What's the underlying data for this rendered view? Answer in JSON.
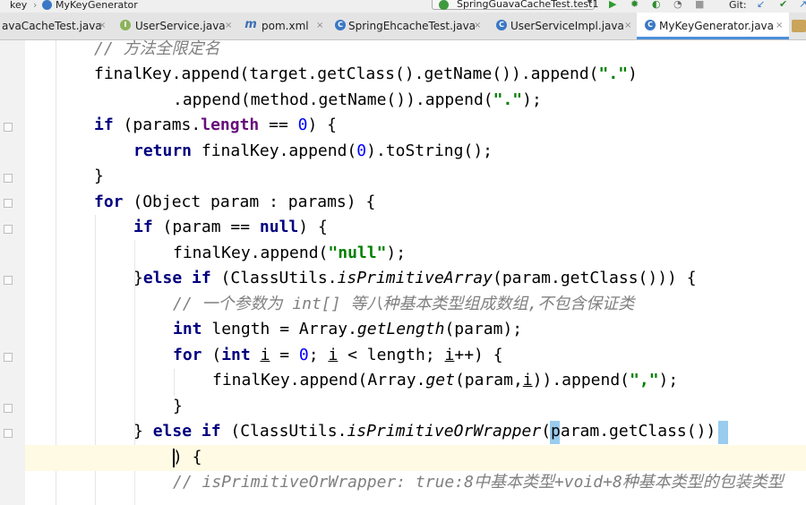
{
  "navbar": {
    "crumb_project": "key",
    "crumb_class": "MyKeyGenerator",
    "run_config": "SpringGuavaCacheTest.test1",
    "vcs_label": "Git:"
  },
  "tabs": [
    {
      "label": "avaCacheTest.java",
      "icon": "class-icon",
      "active": false
    },
    {
      "label": "UserService.java",
      "icon": "interface-icon",
      "active": false
    },
    {
      "label": "pom.xml",
      "icon": "maven-icon",
      "active": false
    },
    {
      "label": "SpringEhcacheTest.java",
      "icon": "test-class-icon",
      "active": false
    },
    {
      "label": "UserServiceImpl.java",
      "icon": "class-icon",
      "active": false
    },
    {
      "label": "MyKeyGenerator.java",
      "icon": "class-icon",
      "active": true
    }
  ],
  "tab_close_glyph": "×",
  "code": {
    "l1": {
      "cmt": "// 方法全限定名"
    },
    "l2": {
      "a": "finalKey.append(target.getClass().getName()).append(",
      "s": "\".\"",
      "b": ")"
    },
    "l3": {
      "a": ".append(method.getName()).append(",
      "s": "\".\"",
      "b": ");"
    },
    "l4": {
      "kw": "if",
      "a": " (params.",
      "f": "length",
      "b": " == ",
      "n": "0",
      "c": ") {"
    },
    "l5": {
      "kw": "return",
      "a": " finalKey.append(",
      "n": "0",
      "b": ").toString();"
    },
    "l6": {
      "a": "}"
    },
    "l7": {
      "kw": "for",
      "a": " (Object param : params) {"
    },
    "l8": {
      "kw": "if",
      "a": " (param == ",
      "kw2": "null",
      "b": ") {"
    },
    "l9": {
      "a": "finalKey.append(",
      "s": "\"null\"",
      "b": ");"
    },
    "l10": {
      "a": "}",
      "kw": "else if",
      "b": " (ClassUtils.",
      "i": "isPrimitiveArray",
      "c": "(param.getClass())) {"
    },
    "l11": {
      "cmt": "// 一个参数为 int[] 等八种基本类型组成数组,不包含保证类"
    },
    "l12": {
      "kw": "int",
      "a": " length = Array.",
      "i": "getLength",
      "b": "(param);"
    },
    "l13": {
      "kw": "for",
      "a": " (",
      "kw2": "int",
      "sp": " ",
      "u1": "i",
      "b": " = ",
      "n": "0",
      "c": "; ",
      "u2": "i",
      "d": " < length; ",
      "u3": "i",
      "e": "++) {"
    },
    "l14": {
      "a": "finalKey.append(Array.",
      "i": "get",
      "b": "(param,",
      "u": "i",
      "c": ")).append(",
      "s": "\",\"",
      "d": ");"
    },
    "l15": {
      "a": "}"
    },
    "l16": {
      "a": "} ",
      "kw": "else if",
      "b": " (ClassUtils.",
      "i": "isPrimitiveOrWrapper",
      "c": "(param.getClass())"
    },
    "l17": {
      "a": ") {"
    },
    "l18": {
      "cmt": "// isPrimitiveOrWrapper: true:8中基本类型+void+8种基本类型的包装类型"
    }
  },
  "colors": {
    "keyword": "#000080",
    "string": "#008000",
    "number": "#0000ff",
    "comment": "#808080",
    "brace_match": "#99ccee",
    "current_line": "#fffae3",
    "active_tab_underline": "#4a90d9"
  }
}
